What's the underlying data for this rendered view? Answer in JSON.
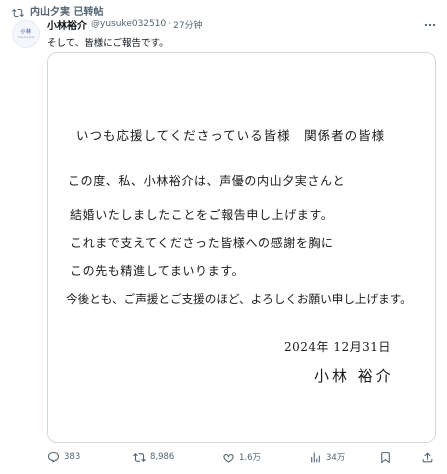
{
  "repost_banner": {
    "text": "内山夕実 已转帖"
  },
  "post": {
    "author_name": "小林裕介",
    "handle": "@yusuke032510",
    "separator": "·",
    "time_ago": "27分钟",
    "text": "そして、皆様にご報告です。",
    "avatar": {
      "line1": "小林",
      "line2": "Yusuke Kob"
    }
  },
  "letter": {
    "greeting": "いつも応援してくださっている皆様　関係者の皆様",
    "lines": [
      "この度、私、小林裕介は、声優の内山夕実さんと",
      "結婚いたしましたことをご報告申し上げます。",
      "これまで支えてくださった皆様への感謝を胸に",
      "この先も精進してまいります。",
      "今後とも、ご声援とご支援のほど、よろしくお願い申し上げます。"
    ],
    "date": "2024年 12月31日",
    "signature": "小林 裕介"
  },
  "actions": {
    "replies": "383",
    "reposts": "8,986",
    "likes": "1.6万",
    "views": "34万"
  },
  "colors": {
    "text": "#0f1419",
    "muted": "#536471",
    "border": "#cfd9de"
  },
  "icons": [
    "repost-icon",
    "more-icon",
    "reply-icon",
    "repost-icon",
    "like-icon",
    "views-icon",
    "bookmark-icon",
    "share-icon"
  ]
}
